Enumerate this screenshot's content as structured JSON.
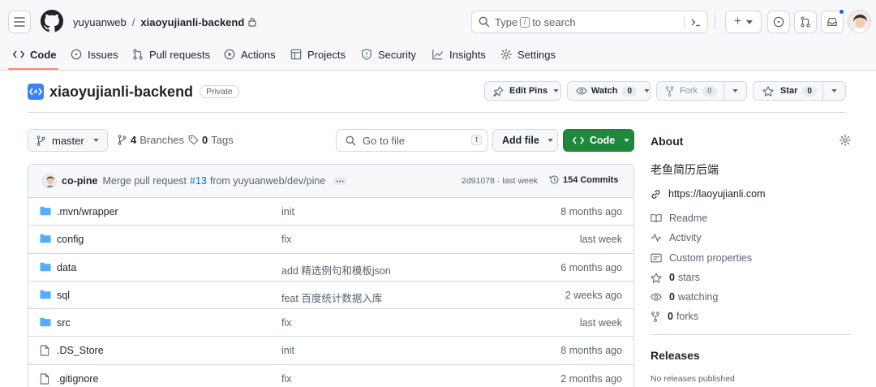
{
  "header": {
    "owner": "yuyuanweb",
    "separator": "/",
    "repo": "xiaoyujianli-backend",
    "search_prefix": "Type",
    "search_key": "/",
    "search_suffix": "to search",
    "command_icon": "terminal-icon",
    "plus_label": "+"
  },
  "tabs": [
    {
      "label": "Code",
      "icon": "code-icon"
    },
    {
      "label": "Issues",
      "icon": "issue-icon"
    },
    {
      "label": "Pull requests",
      "icon": "pull-request-icon"
    },
    {
      "label": "Actions",
      "icon": "play-icon"
    },
    {
      "label": "Projects",
      "icon": "table-icon"
    },
    {
      "label": "Security",
      "icon": "shield-icon"
    },
    {
      "label": "Insights",
      "icon": "graph-icon"
    },
    {
      "label": "Settings",
      "icon": "gear-icon"
    }
  ],
  "repo": {
    "name": "xiaoyujianli-backend",
    "visibility": "Private",
    "edit_pins": "Edit Pins",
    "watch": "Watch",
    "watch_count": "0",
    "fork": "Fork",
    "fork_count": "0",
    "star": "Star",
    "star_count": "0"
  },
  "branchbar": {
    "branch": "master",
    "branches_count": "4",
    "branches_label": "Branches",
    "tags_count": "0",
    "tags_label": "Tags",
    "goto_placeholder": "Go to file",
    "goto_key": "t",
    "add_file": "Add file",
    "code_button": "Code"
  },
  "commit": {
    "author": "co-pine",
    "message_prefix": "Merge pull request",
    "pr_link": "#13",
    "message_suffix": "from yuyuanweb/dev/pine",
    "hash_and_time": "2d91078 · last week",
    "commits_count": "154",
    "commits_label": "Commits"
  },
  "files": [
    {
      "name": ".mvn/wrapper",
      "type": "folder",
      "message": "init",
      "date": "8 months ago"
    },
    {
      "name": "config",
      "type": "folder",
      "message": "fix",
      "date": "last week"
    },
    {
      "name": "data",
      "type": "folder",
      "message": "add 精选例句和模板json",
      "date": "6 months ago"
    },
    {
      "name": "sql",
      "type": "folder",
      "message": "feat 百度统计数据入库",
      "date": "2 weeks ago"
    },
    {
      "name": "src",
      "type": "folder",
      "message": "fix",
      "date": "last week"
    },
    {
      "name": ".DS_Store",
      "type": "file",
      "message": "init",
      "date": "8 months ago"
    },
    {
      "name": ".gitignore",
      "type": "file",
      "message": "fix",
      "date": "2 months ago"
    }
  ],
  "about": {
    "title": "About",
    "description": "老鱼简历后端",
    "website": "https://laoyujianli.com",
    "readme": "Readme",
    "activity": "Activity",
    "custom_properties": "Custom properties",
    "stars_count": "0",
    "stars_label": "stars",
    "watching_count": "0",
    "watching_label": "watching",
    "forks_count": "0",
    "forks_label": "forks",
    "releases_title": "Releases",
    "releases_empty": "No releases published"
  },
  "colors": {
    "accent_link": "#0969da",
    "code_button_bg": "#1f883d",
    "folder_icon": "#54aeff",
    "tab_underline": "#fd8c73",
    "notification_dot": "#0969da"
  }
}
